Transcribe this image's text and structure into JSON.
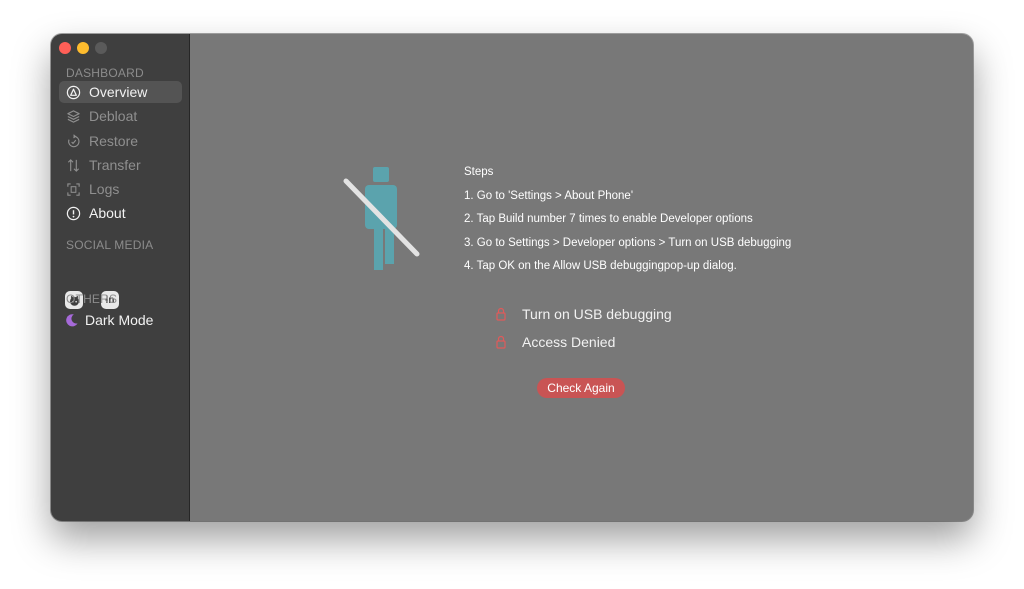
{
  "sidebar": {
    "sections": {
      "dashboard": "DASHBOARD",
      "social": "SOCIAL MEDIA",
      "others": "OTHERS"
    },
    "items": [
      {
        "label": "Overview",
        "icon": "delta-circle-icon"
      },
      {
        "label": "Debloat",
        "icon": "layers-icon"
      },
      {
        "label": "Restore",
        "icon": "restore-icon"
      },
      {
        "label": "Transfer",
        "icon": "transfer-arrows-icon"
      },
      {
        "label": "Logs",
        "icon": "logs-icon"
      },
      {
        "label": "About",
        "icon": "info-circle-icon"
      }
    ],
    "social": [
      {
        "icon": "github-icon"
      },
      {
        "icon": "linkedin-icon",
        "text": "in"
      }
    ],
    "dark_mode_label": "Dark Mode"
  },
  "main": {
    "illustration_icon": "no-usb-person-icon",
    "steps_title": "Steps",
    "steps": [
      "1. Go to 'Settings > About Phone'",
      "2. Tap Build number 7 times to enable Developer options",
      "3. Go to Settings > Developer options > Turn on USB debugging",
      "4. Tap OK on the Allow USB debuggingpop-up dialog."
    ],
    "status": [
      {
        "label": "Turn on USB debugging",
        "icon": "lock-icon"
      },
      {
        "label": "Access Denied",
        "icon": "lock-icon"
      }
    ],
    "check_button": "Check Again"
  },
  "colors": {
    "sidebar_bg": "#3f3f3f",
    "main_bg": "#787878",
    "accent_button": "#c95454",
    "illustration": "#5ba3ad",
    "lock_icon": "#e05a5a",
    "moon": "#a66ad9"
  }
}
